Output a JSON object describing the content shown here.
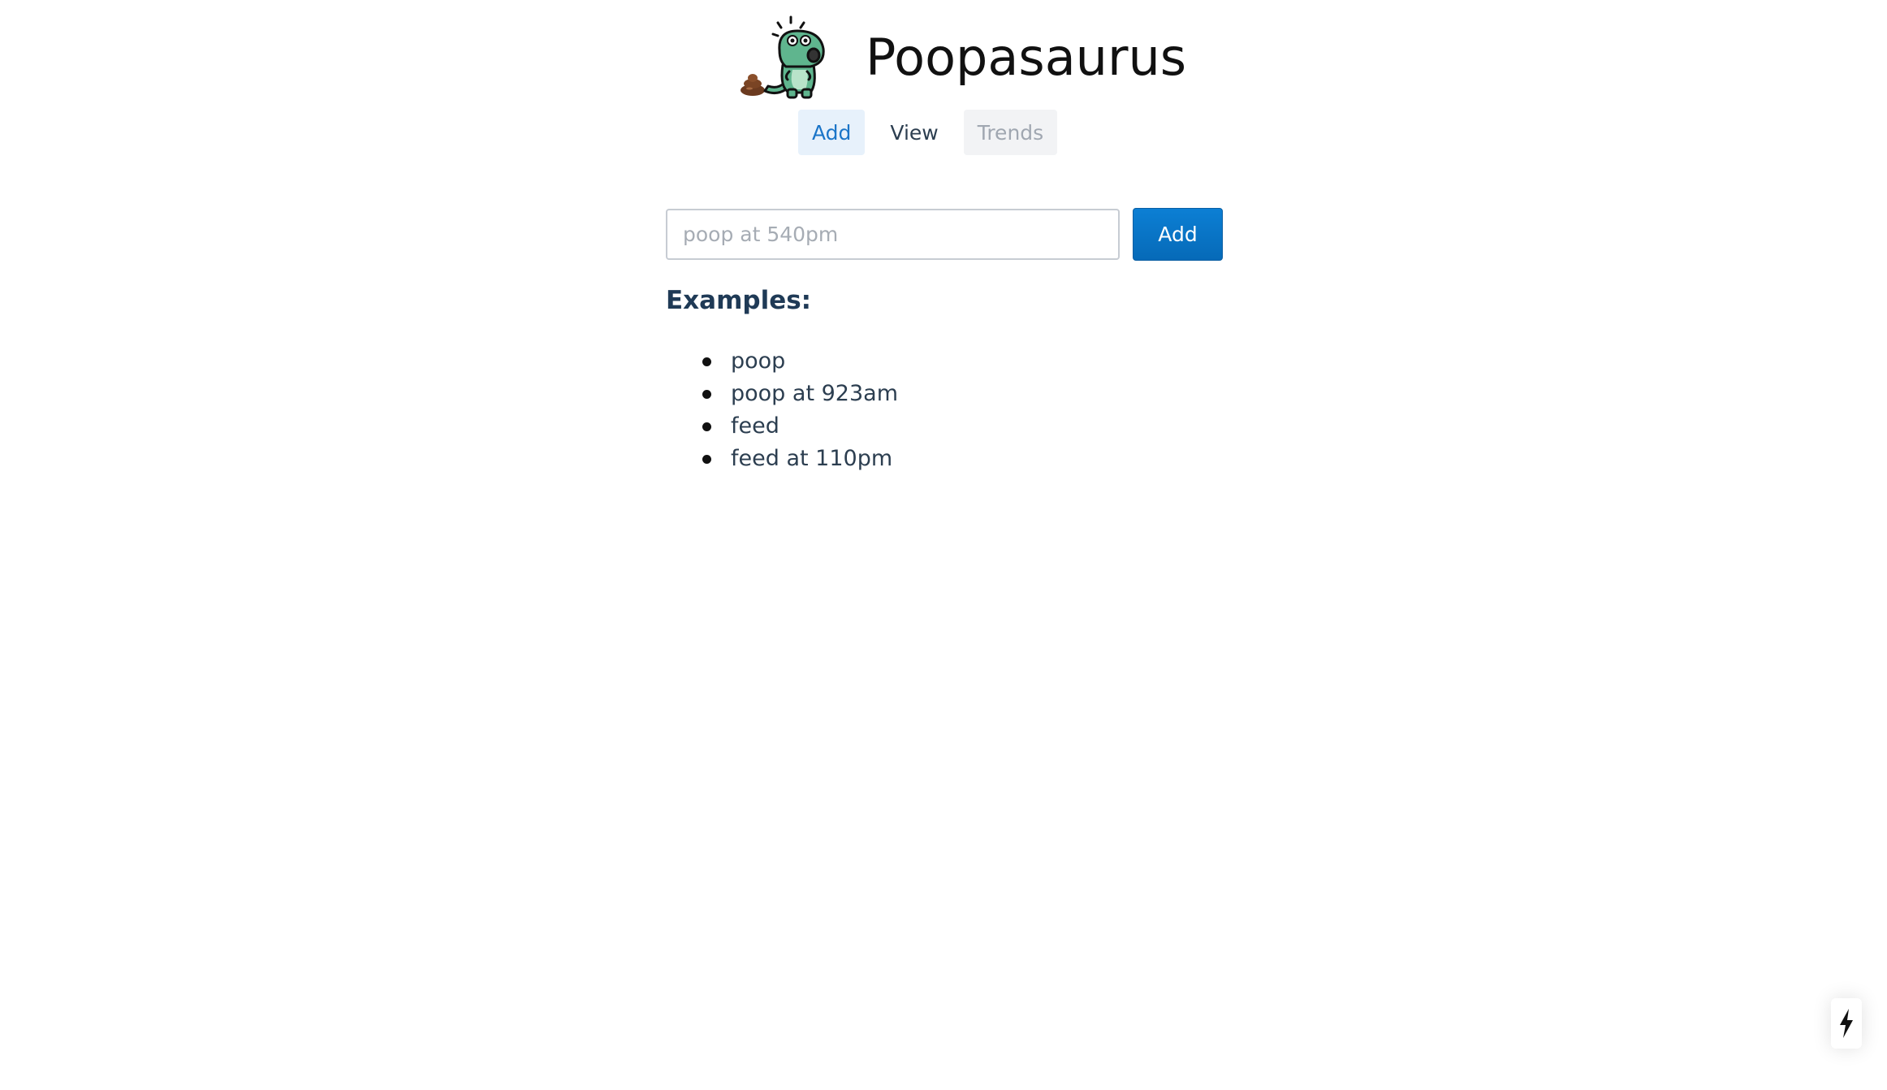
{
  "app": {
    "title": "Poopasaurus"
  },
  "nav": {
    "items": [
      {
        "label": "Add",
        "state": "active"
      },
      {
        "label": "View",
        "state": "normal"
      },
      {
        "label": "Trends",
        "state": "disabled"
      }
    ]
  },
  "form": {
    "input_value": "",
    "input_placeholder": "poop at 540pm",
    "submit_label": "Add"
  },
  "examples": {
    "title": "Examples:",
    "items": [
      "poop",
      "poop at 923am",
      "feed",
      "feed at 110pm"
    ]
  },
  "icons": {
    "logo": "dinosaur-logo-icon",
    "poop": "poop-icon",
    "badge": "lightning-bolt-icon"
  },
  "colors": {
    "accent": "#0c78cf",
    "active_nav_bg": "#e7f1fb",
    "active_nav_text": "#1b75c8",
    "disabled_nav_bg": "#f2f3f5",
    "disabled_nav_text": "#a0a7b1",
    "text": "#2c3e50"
  }
}
